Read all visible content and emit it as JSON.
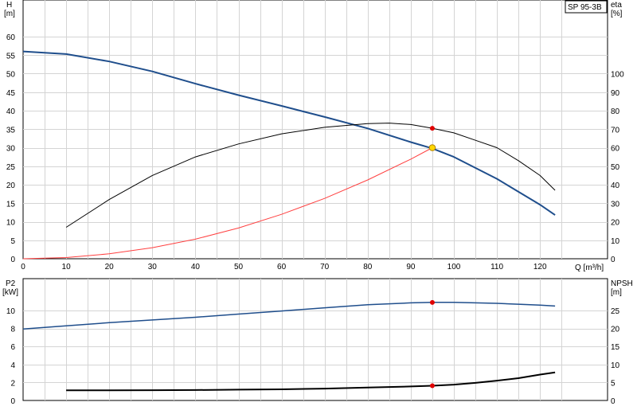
{
  "chart_data": [
    {
      "type": "line",
      "panel": "upper",
      "model_label": "SP 95-3B",
      "xlabel": "Q [m³/h]",
      "ylabel_left": [
        "H",
        "[m]"
      ],
      "ylabel_right": [
        "eta",
        "[%]"
      ],
      "xlim": [
        0,
        130
      ],
      "ylim_left": [
        0,
        65
      ],
      "ylim_right": [
        0,
        130
      ],
      "x_ticks": [
        0,
        10,
        20,
        30,
        40,
        50,
        60,
        70,
        80,
        90,
        100,
        110,
        120
      ],
      "y_ticks_left": [
        0,
        5,
        10,
        15,
        20,
        25,
        30,
        35,
        40,
        45,
        50,
        55,
        60
      ],
      "y_ticks_right": [
        0,
        10,
        20,
        30,
        40,
        50,
        60,
        70,
        80,
        90,
        100
      ],
      "grid": true,
      "series": [
        {
          "key": "head",
          "axis": "left",
          "color": "#1f4e8c",
          "x": [
            0,
            10,
            20,
            30,
            40,
            50,
            60,
            70,
            80,
            90,
            95,
            100,
            110,
            120,
            123.5
          ],
          "y": [
            56,
            55.3,
            53.3,
            50.6,
            47.3,
            44.2,
            41.3,
            38.3,
            35.2,
            31.5,
            29.8,
            27.5,
            21.6,
            14.6,
            11.8
          ]
        },
        {
          "key": "efficiency",
          "axis": "right",
          "color": "#000000",
          "x": [
            10,
            20,
            30,
            40,
            50,
            60,
            70,
            80,
            85,
            90,
            95,
            100,
            105,
            110,
            115,
            120,
            123.5
          ],
          "y": [
            17,
            32,
            45,
            55,
            62,
            67.5,
            71,
            73,
            73.3,
            72.5,
            70.5,
            68,
            64,
            60,
            53,
            45,
            37
          ]
        },
        {
          "key": "system_curve",
          "axis": "left",
          "color": "#ff4040",
          "x": [
            0,
            10,
            20,
            30,
            40,
            50,
            60,
            70,
            80,
            90,
            95
          ],
          "y": [
            0,
            0.33,
            1.33,
            3,
            5.3,
            8.3,
            12,
            16.3,
            21.3,
            26.9,
            30
          ]
        }
      ],
      "markers": [
        {
          "x": 95,
          "y": 70.5,
          "axis": "right",
          "color": "#e00000"
        },
        {
          "x": 95,
          "y": 30,
          "axis": "left",
          "color": "#ffd700"
        }
      ]
    },
    {
      "type": "line",
      "panel": "lower",
      "ylabel_left": [
        "P2",
        "[kW]"
      ],
      "ylabel_right": [
        "NPSH",
        "[m]"
      ],
      "xlim": [
        0,
        130
      ],
      "ylim_left": [
        0,
        12
      ],
      "ylim_right": [
        0,
        30
      ],
      "y_ticks_left": [
        0,
        2,
        4,
        6,
        8,
        10
      ],
      "y_ticks_right": [
        0,
        5,
        10,
        15,
        20,
        25
      ],
      "grid": true,
      "series": [
        {
          "key": "power_p2",
          "axis": "left",
          "color": "#1f4e8c",
          "x": [
            0,
            10,
            20,
            30,
            40,
            50,
            60,
            70,
            80,
            90,
            95,
            100,
            110,
            120,
            123.5
          ],
          "y": [
            7.95,
            8.3,
            8.65,
            8.95,
            9.25,
            9.6,
            9.95,
            10.3,
            10.65,
            10.85,
            10.9,
            10.9,
            10.8,
            10.6,
            10.5
          ]
        },
        {
          "key": "npsh",
          "axis": "right",
          "color": "#000000",
          "x": [
            10,
            20,
            30,
            40,
            50,
            60,
            70,
            80,
            90,
            95,
            100,
            105,
            110,
            115,
            120,
            123.5
          ],
          "y": [
            2.8,
            2.8,
            2.85,
            2.9,
            3.0,
            3.1,
            3.3,
            3.6,
            3.9,
            4.1,
            4.4,
            4.9,
            5.5,
            6.2,
            7.2,
            7.8
          ]
        }
      ],
      "markers": [
        {
          "x": 95,
          "y": 10.9,
          "axis": "left",
          "color": "#e00000"
        },
        {
          "x": 95,
          "y": 4.1,
          "axis": "right",
          "color": "#e00000"
        }
      ]
    }
  ]
}
